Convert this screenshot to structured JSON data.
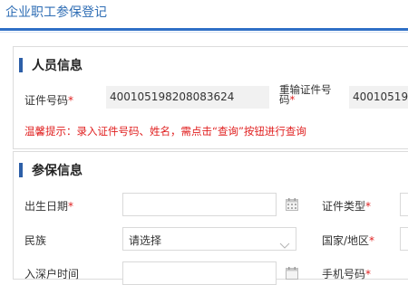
{
  "page": {
    "title": "企业职工参保登记"
  },
  "person_section": {
    "title": "人员信息",
    "id_label": "证件号码",
    "id_value": "400105198208083624",
    "reenter_label_line1": "重输证件号",
    "reenter_label_line2": "码",
    "reenter_value": "40010519",
    "hint": "温馨提示：录入证件号码、姓名，需点击“查询”按钮进行查询"
  },
  "insure_section": {
    "title": "参保信息",
    "birth_label": "出生日期",
    "birth_value": "",
    "id_type_label": "证件类型",
    "ethnicity_label": "民族",
    "ethnicity_value": "请选择",
    "country_label": "国家/地区",
    "hire_date_label": "入深户时间",
    "phone_label": "手机号码"
  },
  "required_marker": "*",
  "colors": {
    "title_blue": "#2f6eb5",
    "section_bar": "#2d5fa8",
    "required_red": "#e02020",
    "readonly_bg": "#f1f1f1"
  }
}
